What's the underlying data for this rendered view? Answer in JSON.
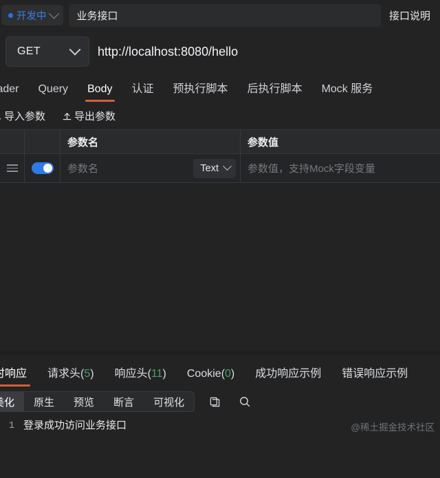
{
  "header": {
    "status_label": "开发中",
    "status_color": "#3b7ce8",
    "api_name": "业务接口",
    "doc_button": "接口说明"
  },
  "request": {
    "method": "GET",
    "url": "http://localhost:8080/hello",
    "tabs": [
      {
        "label": "Header",
        "active": false
      },
      {
        "label": "Query",
        "active": false
      },
      {
        "label": "Body",
        "active": true
      },
      {
        "label": "认证",
        "active": false
      },
      {
        "label": "预执行脚本",
        "active": false
      },
      {
        "label": "后执行脚本",
        "active": false
      },
      {
        "label": "Mock 服务",
        "active": false
      }
    ],
    "active_tab_color": "#d4603a",
    "import_button": "导入参数",
    "export_button": "导出参数",
    "table": {
      "columns": [
        "参数名",
        "参数值"
      ],
      "rows": [
        {
          "enabled": true,
          "name_placeholder": "参数名",
          "type": "Text",
          "value_placeholder": "参数值，支持Mock字段变量"
        }
      ]
    }
  },
  "response": {
    "tabs": [
      {
        "label": "实时响应",
        "count": null,
        "active": true
      },
      {
        "label": "请求头",
        "count": "5",
        "active": false
      },
      {
        "label": "响应头",
        "count": "11",
        "active": false
      },
      {
        "label": "Cookie",
        "count": "0",
        "active": false
      },
      {
        "label": "成功响应示例",
        "count": null,
        "active": false
      },
      {
        "label": "错误响应示例",
        "count": null,
        "active": false
      }
    ],
    "count_color": "#4aa06a",
    "view_modes": [
      {
        "label": "美化",
        "active": true
      },
      {
        "label": "原生",
        "active": false
      },
      {
        "label": "预览",
        "active": false
      },
      {
        "label": "断言",
        "active": false
      },
      {
        "label": "可视化",
        "active": false
      }
    ],
    "copy_icon": "copy-icon",
    "search_icon": "search-icon",
    "body_lines": [
      {
        "number": "1",
        "text": "登录成功访问业务接口"
      }
    ],
    "watermark": "@稀土掘金技术社区"
  }
}
